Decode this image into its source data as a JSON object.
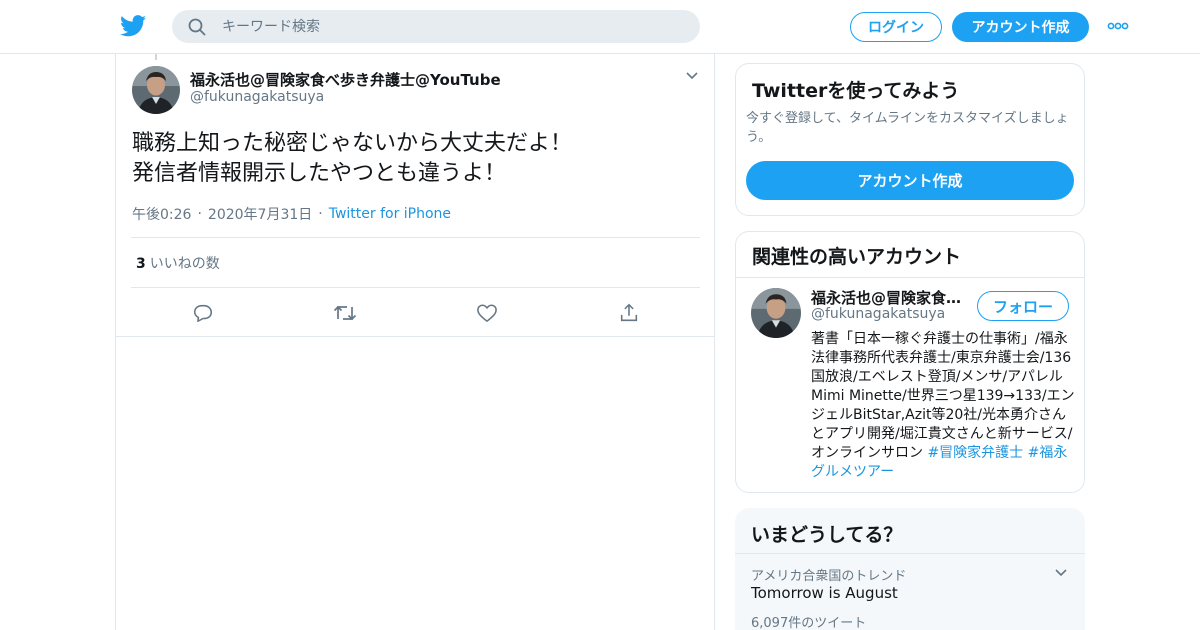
{
  "topbar": {
    "logo_icon": "twitter-bird-icon",
    "search_placeholder": "キーワード検索",
    "login_label": "ログイン",
    "signup_label": "アカウント作成",
    "more_icon": "more-dots-icon",
    "brand_color": "#1da1f2"
  },
  "tweet": {
    "author_name": "福永活也@冒険家食べ歩き弁護士@YouTube",
    "author_handle": "@fukunagakatsuya",
    "text_line1": "職務上知った秘密じゃないから大丈夫だよ！",
    "text_line2": "発信者情報開示したやつとも違うよ！",
    "time": "午後0:26",
    "date": "2020年7月31日",
    "separator": "·",
    "source": "Twitter for iPhone",
    "like_count": "3",
    "like_label": "いいねの数",
    "actions": [
      "reply-icon",
      "retweet-icon",
      "like-icon",
      "share-icon"
    ]
  },
  "sidebar": {
    "signup_card": {
      "title": "Twitterを使ってみよう",
      "description": "今すぐ登録して、タイムラインをカスタマイズしましょう。",
      "button_label": "アカウント作成"
    },
    "related_card": {
      "title": "関連性の高いアカウント",
      "account": {
        "name": "福永活也@冒険家食べ歩き弁護士@YouTube",
        "handle": "@fukunagakatsuya",
        "follow_label": "フォロー",
        "bio": "著書「日本一稼ぐ弁護士の仕事術」/福永法律事務所代表弁護士/東京弁護士会/136国放浪/エベレスト登頂/メンサ/アパレルMimi Minette/世界三つ星139→133/エンジェルBitStar,Azit等20社/光本勇介さんとアプリ開発/堀江貴文さんと新サービス/オンラインサロン",
        "hashtag1": "#冒険家弁護士",
        "hashtag2": "#福永グルメツアー"
      }
    },
    "trends_card": {
      "title": "いまどうしてる？",
      "trend": {
        "location": "アメリカ合衆国のトレンド",
        "name": "Tomorrow is August",
        "count": "6,097件のツイート"
      }
    }
  }
}
